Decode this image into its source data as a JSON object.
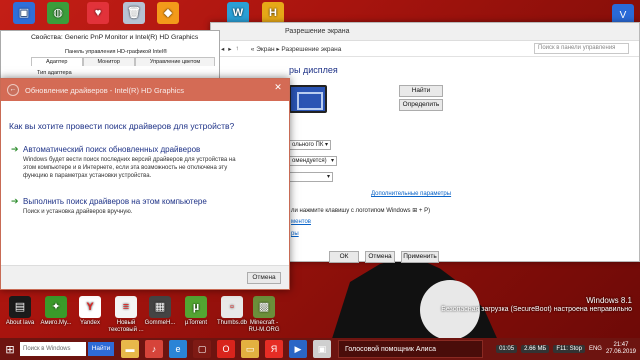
{
  "desktop": {
    "top_icons": [
      {
        "name": "app-icon-1",
        "color": "#2f6fd8",
        "glyph": "▣"
      },
      {
        "name": "app-icon-2",
        "color": "#3b9d3b",
        "glyph": "◍"
      },
      {
        "name": "app-icon-3",
        "color": "#e2323a",
        "glyph": "♥"
      },
      {
        "name": "recycle-bin",
        "color": "#b7c3d3",
        "glyph": "🗑"
      },
      {
        "name": "app-icon-5",
        "color": "#f39a1a",
        "glyph": "◆"
      },
      {
        "name": "app-icon-6",
        "color": "#2a9fd6",
        "glyph": "W"
      },
      {
        "name": "app-icon-7",
        "color": "#e6a817",
        "glyph": "H"
      }
    ],
    "bottom_icons": [
      {
        "label": "About lava",
        "color": "#1b1b1b",
        "glyph": "▤"
      },
      {
        "label": "Амиго.Му...",
        "color": "#3a9a2a",
        "glyph": "✦"
      },
      {
        "label": "Yandex",
        "color": "#ffffff",
        "glyph": "Y"
      },
      {
        "label": "Новый текстовый ...",
        "color": "#f4f4f4",
        "glyph": "≡"
      },
      {
        "label": "GommeH...",
        "color": "#444444",
        "glyph": "▦"
      },
      {
        "label": "µTorrent",
        "color": "#53a532",
        "glyph": "µ"
      },
      {
        "label": "Thumbs.db",
        "color": "#e8e8e8",
        "glyph": "▫"
      },
      {
        "label": "Minecraft - RU-M.ORG",
        "color": "#6b8f3a",
        "glyph": "▩"
      }
    ],
    "os_name": "Windows 8.1",
    "secure_boot_text": "Безопасная загрузка (SecureBoot) настроена неправильно",
    "top_right_icon_glyph": "V"
  },
  "resolution_window": {
    "title": "Разрешение экрана",
    "address": {
      "back": "◂",
      "forward": "▸",
      "up": "↑",
      "crumbs": "« Экран  ▸  Разрешение экрана"
    },
    "search_placeholder": "Поиск в панели управления",
    "heading": "ры дисплея",
    "buttons": {
      "find": "Найти",
      "identify": "Определить",
      "ok": "ОК",
      "cancel": "Отмена",
      "apply": "Применить"
    },
    "combos": [
      "ольного ПК",
      "омендуется)",
      ""
    ],
    "advanced_link": "Дополнительные параметры",
    "win_p_text": "ли нажмите клавишу с логотипом Windows",
    "win_p_suffix": "+ P)",
    "link2": "ментов",
    "link3": "ры"
  },
  "properties_window": {
    "title": "Свойства: Generic PnP Monitor и Intel(R) HD Graphics",
    "panel_label": "Панель управления HD-графикой Intel®",
    "tabs": [
      "Адаптер",
      "Монитор",
      "Управление цветом"
    ],
    "type_label": "Тип адаптера"
  },
  "driver_dialog": {
    "title": "Обновление драйверов - Intel(R) HD Graphics",
    "back_glyph": "←",
    "close_glyph": "✕",
    "question": "Как вы хотите провести поиск драйверов для устройств?",
    "option1": {
      "title": "Автоматический поиск обновленных драйверов",
      "desc": "Windows будет вести поиск последних версий драйверов для устройства на этом компьютере и в Интернете, если эта возможность не отключена эту функцию в параметрах установки устройства."
    },
    "option2": {
      "title": "Выполнить поиск драйверов на этом компьютере",
      "desc": "Поиск и установка драйверов вручную."
    },
    "cancel": "Отмена"
  },
  "taskbar": {
    "search_placeholder": "Поиск в Windows",
    "find_button": "Найти",
    "pinned": [
      {
        "name": "folder",
        "color": "#e8b84a",
        "glyph": "▬"
      },
      {
        "name": "music",
        "color": "#d6443a",
        "glyph": "♪"
      },
      {
        "name": "ie",
        "color": "#2a84d6",
        "glyph": "e"
      },
      {
        "name": "pinned-4",
        "color": "#7e1a14",
        "glyph": "▢"
      },
      {
        "name": "opera",
        "color": "#d8241c",
        "glyph": "O"
      },
      {
        "name": "explorer",
        "color": "#e3b040",
        "glyph": "▭"
      },
      {
        "name": "yandex",
        "color": "#e62d25",
        "glyph": "Я"
      },
      {
        "name": "media",
        "color": "#2a66c6",
        "glyph": "▶"
      },
      {
        "name": "device-manager",
        "color": "#cfcfcf",
        "glyph": "▣"
      }
    ],
    "assistant": "Голосовой помощник Алиса",
    "tray": {
      "pills": [
        "01:05",
        "2.66 МБ",
        "F11: Stop"
      ],
      "lang": "ENG",
      "time": "21:47",
      "date": "27.06.2019"
    }
  }
}
